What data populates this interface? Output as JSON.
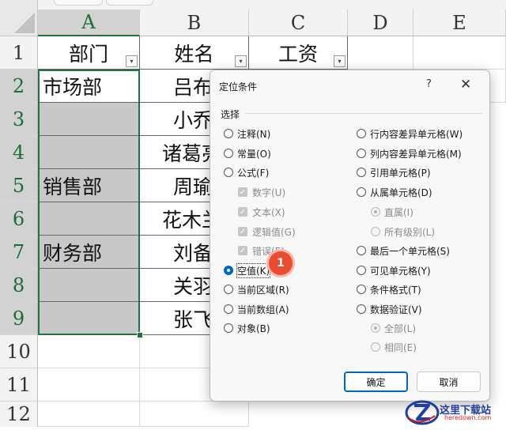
{
  "sheet": {
    "columns": [
      "A",
      "B",
      "C",
      "D",
      "E"
    ],
    "rows": [
      "1",
      "2",
      "3",
      "4",
      "5",
      "6",
      "7",
      "8",
      "9",
      "10",
      "11",
      "12"
    ],
    "headers": {
      "dept": "部门",
      "name": "姓名",
      "salary": "工资"
    },
    "filter_icon": "▾",
    "dept_values": {
      "r2": "市场部",
      "r5": "销售部",
      "r7": "财务部"
    },
    "names": [
      "吕布",
      "小乔",
      "诸葛亮",
      "周瑜",
      "花木兰",
      "刘备",
      "关羽",
      "张飞"
    ]
  },
  "dialog": {
    "title": "定位条件",
    "help": "?",
    "close": "✕",
    "group_label": "选择",
    "left_options": {
      "comments": "注释(N)",
      "constants": "常量(O)",
      "formulas": "公式(F)",
      "numbers": "数字(U)",
      "text": "文本(X)",
      "logicals": "逻辑值(G)",
      "errors": "错误(E)",
      "blanks": "空值(K)",
      "current_region": "当前区域(R)",
      "current_array": "当前数组(A)",
      "objects": "对象(B)"
    },
    "right_options": {
      "row_diff": "行内容差异单元格(W)",
      "col_diff": "列内容差异单元格(M)",
      "precedents": "引用单元格(P)",
      "dependents": "从属单元格(D)",
      "direct": "直属(I)",
      "all_levels": "所有级别(L)",
      "last_cell": "最后一个单元格(S)",
      "visible": "可见单元格(Y)",
      "cond_format": "条件格式(T)",
      "data_validation": "数据验证(V)",
      "dv_all": "全部(L)",
      "dv_same": "相同(E)"
    },
    "check_mark": "✓",
    "ok_label": "确定",
    "cancel_label": "取消",
    "badge_number": "1"
  },
  "watermark": {
    "text": "这里下载站",
    "sub": "heredown.com"
  }
}
